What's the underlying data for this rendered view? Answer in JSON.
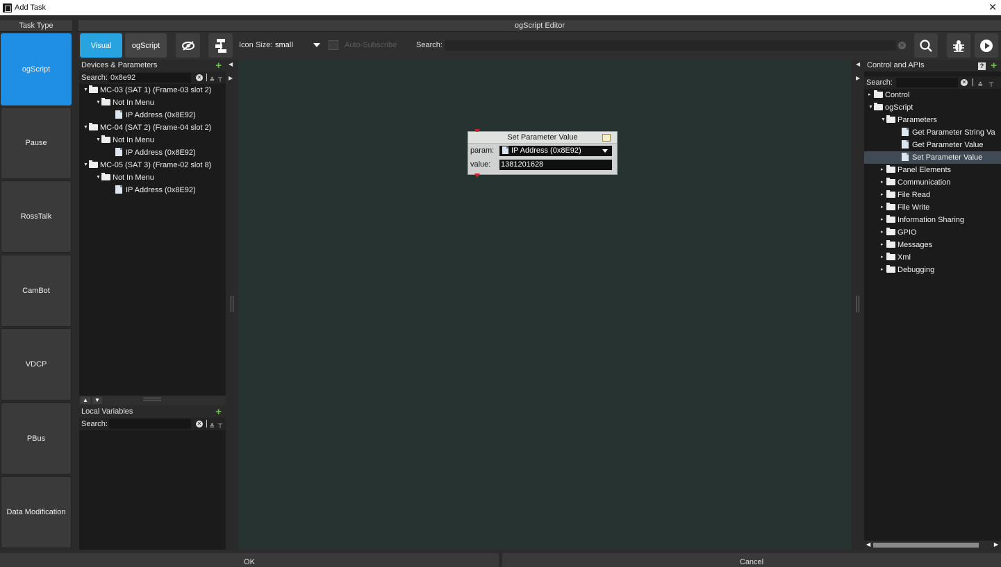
{
  "window": {
    "title": "Add Task"
  },
  "task_type": {
    "header": "Task Type",
    "items": [
      {
        "label": "ogScript",
        "active": true
      },
      {
        "label": "Pause",
        "active": false
      },
      {
        "label": "RossTalk",
        "active": false
      },
      {
        "label": "CamBot",
        "active": false
      },
      {
        "label": "VDCP",
        "active": false
      },
      {
        "label": "PBus",
        "active": false
      },
      {
        "label": "Data Modification",
        "active": false
      }
    ]
  },
  "editor": {
    "header": "ogScript Editor",
    "toolbar": {
      "visual_label": "Visual",
      "ogscript_label": "ogScript",
      "icon_size_label": "Icon Size:",
      "icon_size_value": "small",
      "auto_subscribe_label": "Auto-Subscribe",
      "search_label": "Search:",
      "search_value": ""
    }
  },
  "devices_panel": {
    "title": "Devices & Parameters",
    "search_label": "Search:",
    "search_value": "0x8e92",
    "tree": [
      {
        "level": 0,
        "type": "folder",
        "label": "MC-03 (SAT 1) (Frame-03 slot 2)"
      },
      {
        "level": 1,
        "type": "folder",
        "label": "Not In Menu"
      },
      {
        "level": 2,
        "type": "file",
        "label": "IP Address (0x8E92)"
      },
      {
        "level": 0,
        "type": "folder",
        "label": "MC-04 (SAT 2) (Frame-04 slot 2)"
      },
      {
        "level": 1,
        "type": "folder",
        "label": "Not In Menu"
      },
      {
        "level": 2,
        "type": "file",
        "label": "IP Address (0x8E92)"
      },
      {
        "level": 0,
        "type": "folder",
        "label": "MC-05 (SAT 3) (Frame-02 slot 8)"
      },
      {
        "level": 1,
        "type": "folder",
        "label": "Not In Menu"
      },
      {
        "level": 2,
        "type": "file",
        "label": "IP Address (0x8E92)"
      }
    ]
  },
  "local_variables": {
    "title": "Local Variables",
    "search_label": "Search:",
    "search_value": ""
  },
  "node": {
    "title": "Set Parameter Value",
    "param_label": "param:",
    "param_value": "IP Address (0x8E92)",
    "value_label": "value:",
    "value_value": "1381201628"
  },
  "apis_panel": {
    "title": "Control and APIs",
    "search_label": "Search:",
    "search_value": "",
    "tree": [
      {
        "level": 0,
        "type": "folder",
        "label": "Control",
        "expanded": false
      },
      {
        "level": 0,
        "type": "folder",
        "label": "ogScript",
        "expanded": true
      },
      {
        "level": 1,
        "type": "folder",
        "label": "Parameters",
        "expanded": true
      },
      {
        "level": 2,
        "type": "file",
        "label": "Get Parameter String Va"
      },
      {
        "level": 2,
        "type": "file",
        "label": "Get Parameter Value"
      },
      {
        "level": 2,
        "type": "file",
        "label": "Set Parameter Value",
        "selected": true
      },
      {
        "level": 1,
        "type": "folder",
        "label": "Panel Elements",
        "expanded": false
      },
      {
        "level": 1,
        "type": "folder",
        "label": "Communication",
        "expanded": false
      },
      {
        "level": 1,
        "type": "folder",
        "label": "File Read",
        "expanded": false
      },
      {
        "level": 1,
        "type": "folder",
        "label": "File Write",
        "expanded": false
      },
      {
        "level": 1,
        "type": "folder",
        "label": "Information Sharing",
        "expanded": false
      },
      {
        "level": 1,
        "type": "folder",
        "label": "GPIO",
        "expanded": false
      },
      {
        "level": 1,
        "type": "folder",
        "label": "Messages",
        "expanded": false
      },
      {
        "level": 1,
        "type": "folder",
        "label": "Xml",
        "expanded": false
      },
      {
        "level": 1,
        "type": "folder",
        "label": "Debugging",
        "expanded": false
      }
    ]
  },
  "footer": {
    "ok_label": "OK",
    "cancel_label": "Cancel"
  },
  "colors": {
    "accent": "#28a3e0",
    "task_active": "#1f8fe6",
    "canvas": "#263330",
    "add_green": "#6cc644",
    "node_marker": "#d42020"
  },
  "icons": [
    "close-icon",
    "eye-slash-icon",
    "flowchart-icon",
    "search-icon",
    "bug-icon",
    "play-icon",
    "add-icon",
    "help-icon",
    "folder-icon",
    "file-icon",
    "edit-icon"
  ]
}
